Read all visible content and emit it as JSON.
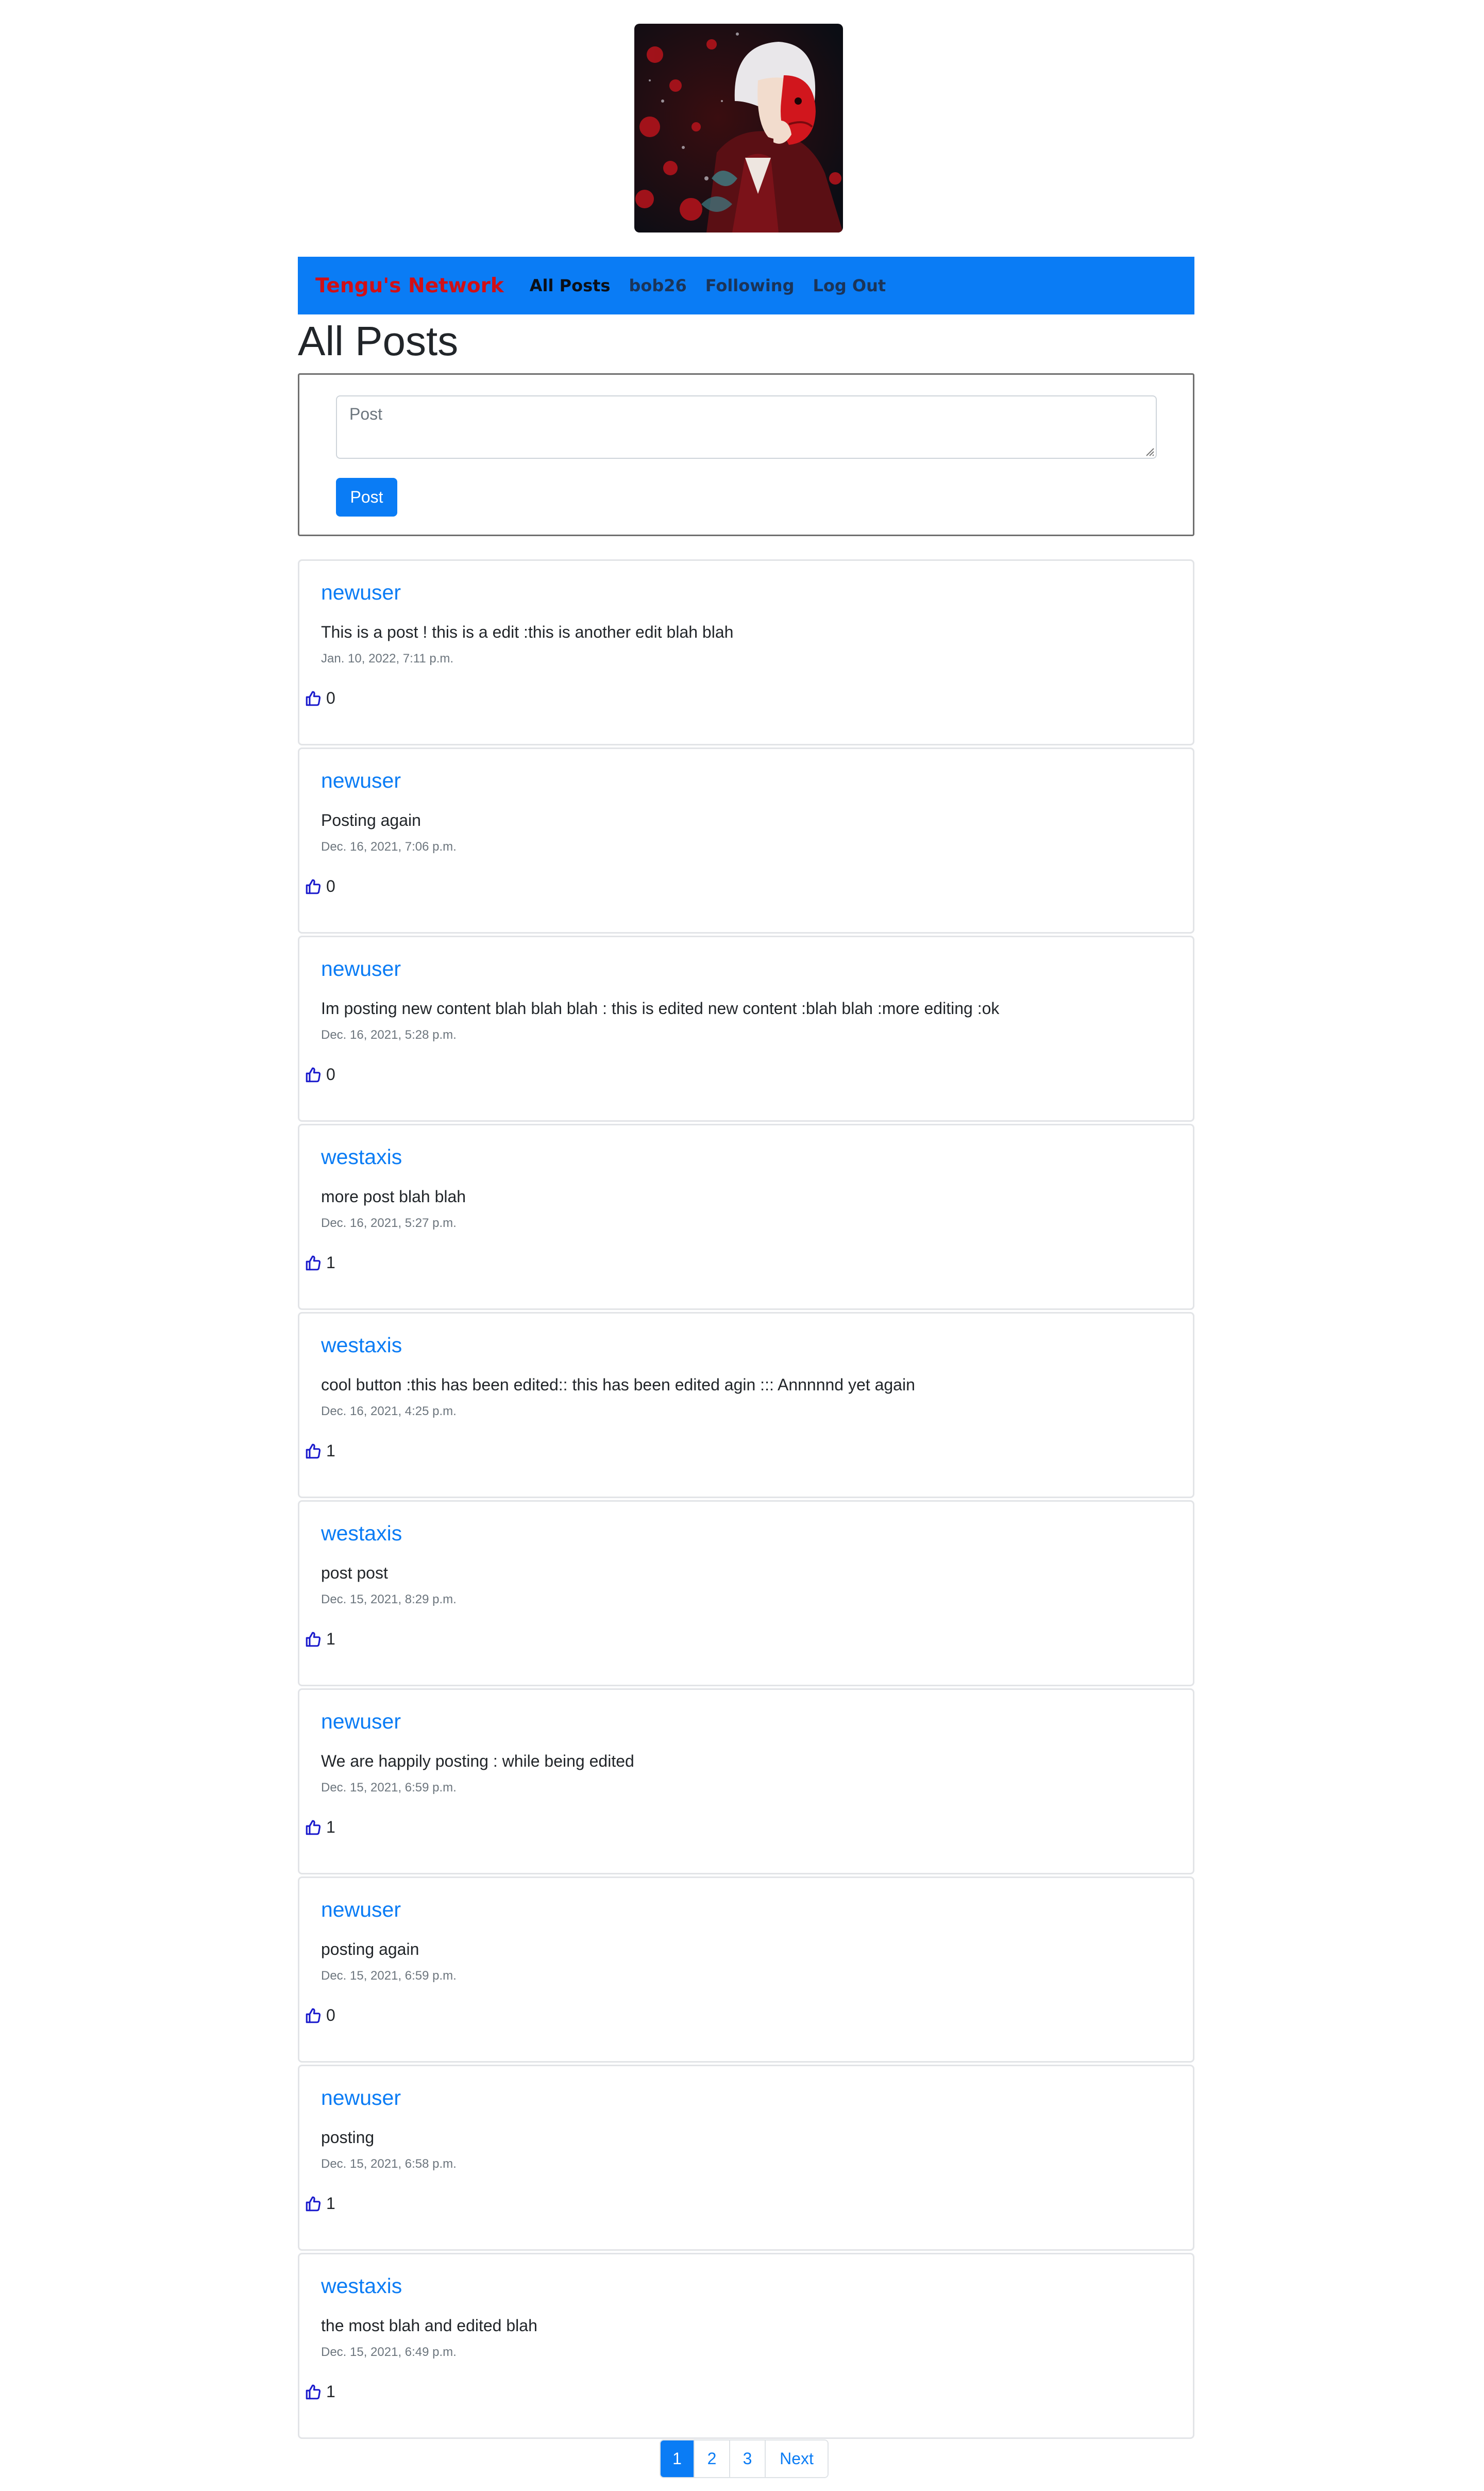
{
  "header": {
    "banner_alt": "Tengu banner image"
  },
  "navbar": {
    "brand": "Tengu's Network",
    "links": [
      {
        "label": "All Posts",
        "active": true
      },
      {
        "label": "bob26",
        "active": false
      },
      {
        "label": "Following",
        "active": false
      },
      {
        "label": "Log Out",
        "active": false
      }
    ]
  },
  "page": {
    "title": "All Posts"
  },
  "compose": {
    "placeholder": "Post",
    "button_label": "Post"
  },
  "posts": [
    {
      "author": "newuser",
      "body": "This is a post ! this is a edit :this is another edit blah blah",
      "date": "Jan. 10, 2022, 7:11 p.m.",
      "likes": "0"
    },
    {
      "author": "newuser",
      "body": "Posting again",
      "date": "Dec. 16, 2021, 7:06 p.m.",
      "likes": "0"
    },
    {
      "author": "newuser",
      "body": "Im posting new content blah blah blah : this is edited new content :blah blah :more editing :ok",
      "date": "Dec. 16, 2021, 5:28 p.m.",
      "likes": "0"
    },
    {
      "author": "westaxis",
      "body": "more post blah blah",
      "date": "Dec. 16, 2021, 5:27 p.m.",
      "likes": "1"
    },
    {
      "author": "westaxis",
      "body": "cool button :this has been edited:: this has been edited agin ::: Annnnnd yet again",
      "date": "Dec. 16, 2021, 4:25 p.m.",
      "likes": "1"
    },
    {
      "author": "westaxis",
      "body": "post post",
      "date": "Dec. 15, 2021, 8:29 p.m.",
      "likes": "1"
    },
    {
      "author": "newuser",
      "body": "We are happily posting : while being edited",
      "date": "Dec. 15, 2021, 6:59 p.m.",
      "likes": "1"
    },
    {
      "author": "newuser",
      "body": "posting again",
      "date": "Dec. 15, 2021, 6:59 p.m.",
      "likes": "0"
    },
    {
      "author": "newuser",
      "body": "posting",
      "date": "Dec. 15, 2021, 6:58 p.m.",
      "likes": "1"
    },
    {
      "author": "westaxis",
      "body": "the most blah and edited blah",
      "date": "Dec. 15, 2021, 6:49 p.m.",
      "likes": "1"
    }
  ],
  "pagination": {
    "pages": [
      "1",
      "2",
      "3"
    ],
    "current": "1",
    "next_label": "Next"
  },
  "colors": {
    "accent": "#0a7cf5",
    "brand": "#d10f16",
    "like_icon": "#1a1acc"
  },
  "icons": {
    "like": "thumbs-up-icon"
  }
}
